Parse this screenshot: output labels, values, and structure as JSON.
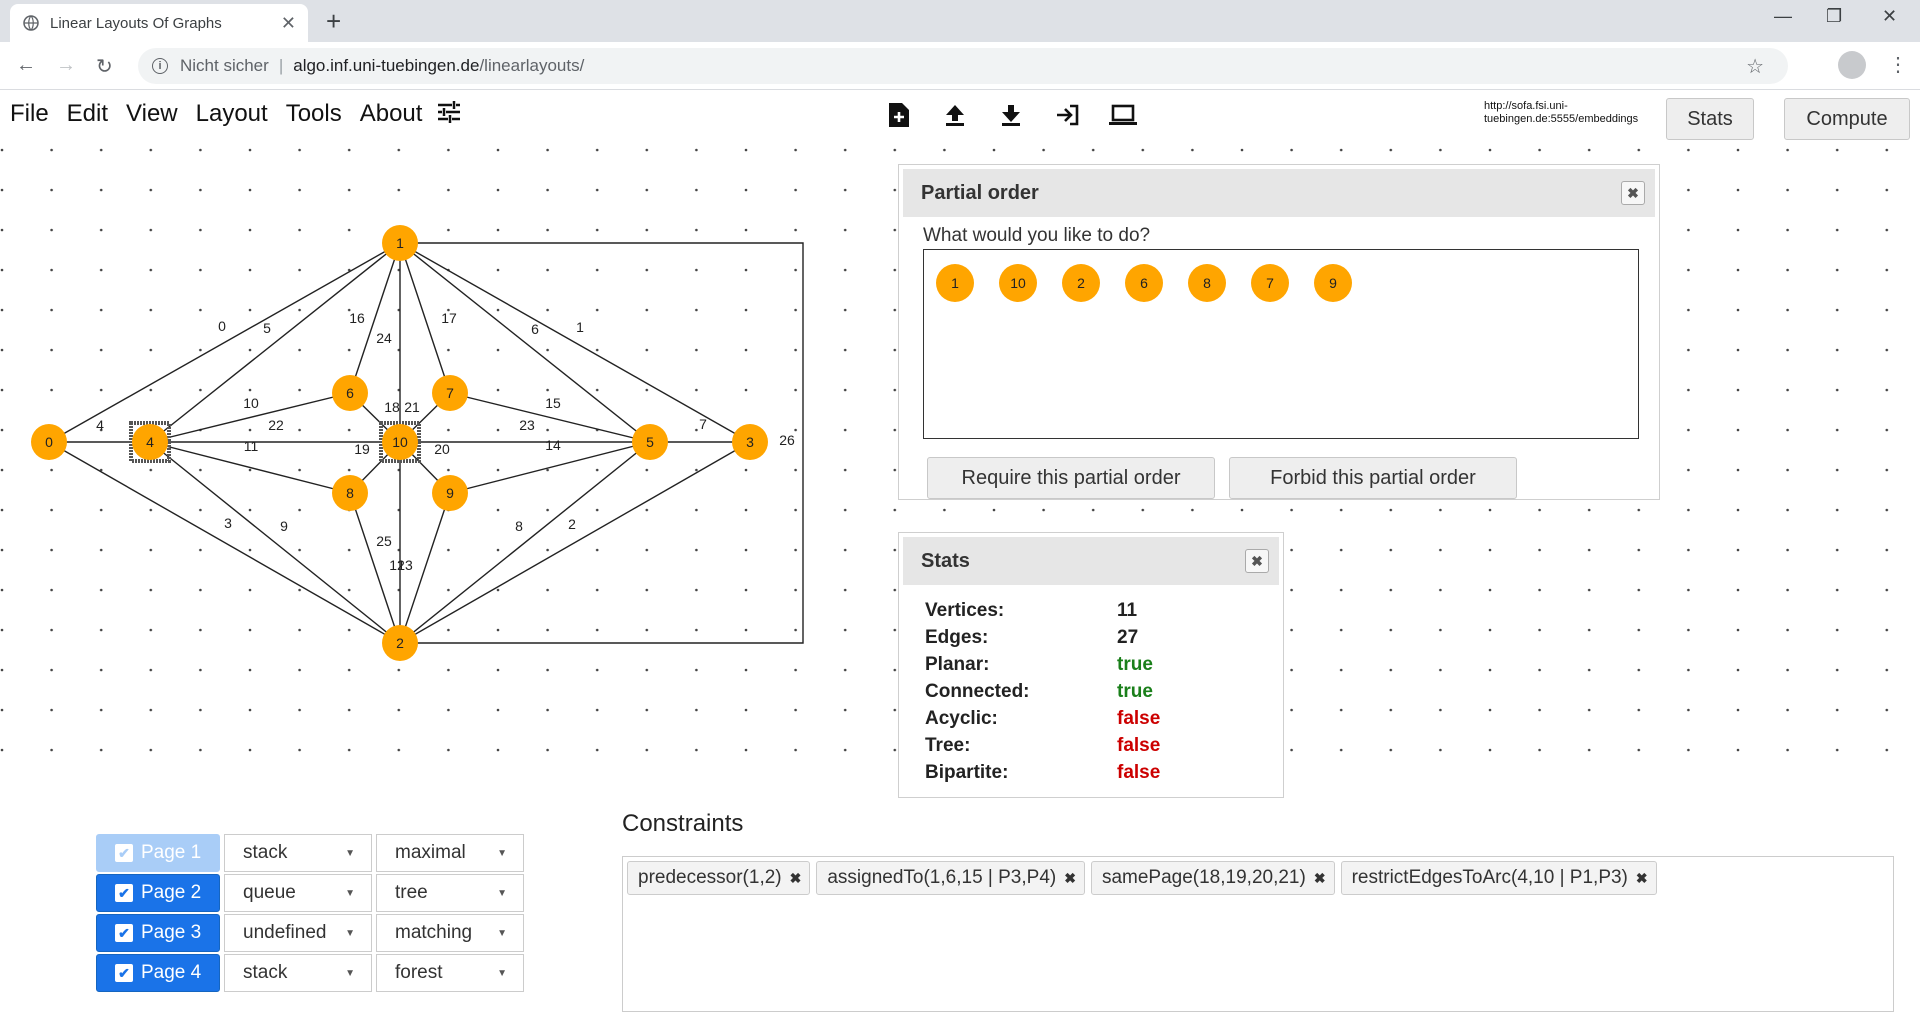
{
  "browser": {
    "tab_title": "Linear Layouts Of Graphs",
    "security": "Nicht sicher",
    "host": "algo.inf.uni-tuebingen.de",
    "path": "/linearlayouts/"
  },
  "menu": {
    "file": "File",
    "edit": "Edit",
    "view": "View",
    "layout": "Layout",
    "tools": "Tools",
    "about": "About"
  },
  "toolbar": {
    "server_url": "http://sofa.fsi.uni-tuebingen.de:5555/embeddings",
    "stats_label": "Stats",
    "compute_label": "Compute"
  },
  "graph": {
    "vertices": [
      {
        "id": "0"
      },
      {
        "id": "1"
      },
      {
        "id": "2"
      },
      {
        "id": "3"
      },
      {
        "id": "4"
      },
      {
        "id": "5"
      },
      {
        "id": "6"
      },
      {
        "id": "7"
      },
      {
        "id": "8"
      },
      {
        "id": "9"
      },
      {
        "id": "10"
      }
    ],
    "selected_vertices": [
      "4",
      "10"
    ],
    "edge_labels": [
      "0",
      "1",
      "2",
      "3",
      "4",
      "5",
      "6",
      "7",
      "8",
      "9",
      "10",
      "11",
      "12",
      "13",
      "14",
      "15",
      "16",
      "17",
      "18",
      "19",
      "20",
      "21",
      "22",
      "23",
      "24",
      "25",
      "26"
    ]
  },
  "partial_order": {
    "title": "Partial order",
    "question": "What would you like to do?",
    "nodes": [
      "1",
      "10",
      "2",
      "6",
      "8",
      "7",
      "9"
    ],
    "require_label": "Require this partial order",
    "forbid_label": "Forbid this partial order"
  },
  "stats": {
    "title": "Stats",
    "rows": [
      {
        "label": "Vertices:",
        "value": "11"
      },
      {
        "label": "Edges:",
        "value": "27"
      },
      {
        "label": "Planar:",
        "value": "true"
      },
      {
        "label": "Connected:",
        "value": "true"
      },
      {
        "label": "Acyclic:",
        "value": "false"
      },
      {
        "label": "Tree:",
        "value": "false"
      },
      {
        "label": "Bipartite:",
        "value": "false"
      }
    ]
  },
  "pages": [
    {
      "label": "Page 1",
      "enabled": false,
      "type": "stack",
      "constraint": "maximal"
    },
    {
      "label": "Page 2",
      "enabled": true,
      "type": "queue",
      "constraint": "tree"
    },
    {
      "label": "Page 3",
      "enabled": true,
      "type": "undefined",
      "constraint": "matching"
    },
    {
      "label": "Page 4",
      "enabled": true,
      "type": "stack",
      "constraint": "forest"
    }
  ],
  "constraints": {
    "title": "Constraints",
    "tags": [
      "predecessor(1,2)",
      "assignedTo(1,6,15 | P3,P4)",
      "samePage(18,19,20,21)",
      "restrictEdgesToArc(4,10 | P1,P3)"
    ]
  },
  "colors": {
    "vertex": "#ffa500",
    "page_active": "#1a73e8",
    "page_inactive": "#a9cdf7",
    "true": "#1a7f1a",
    "false": "#cc0000"
  }
}
